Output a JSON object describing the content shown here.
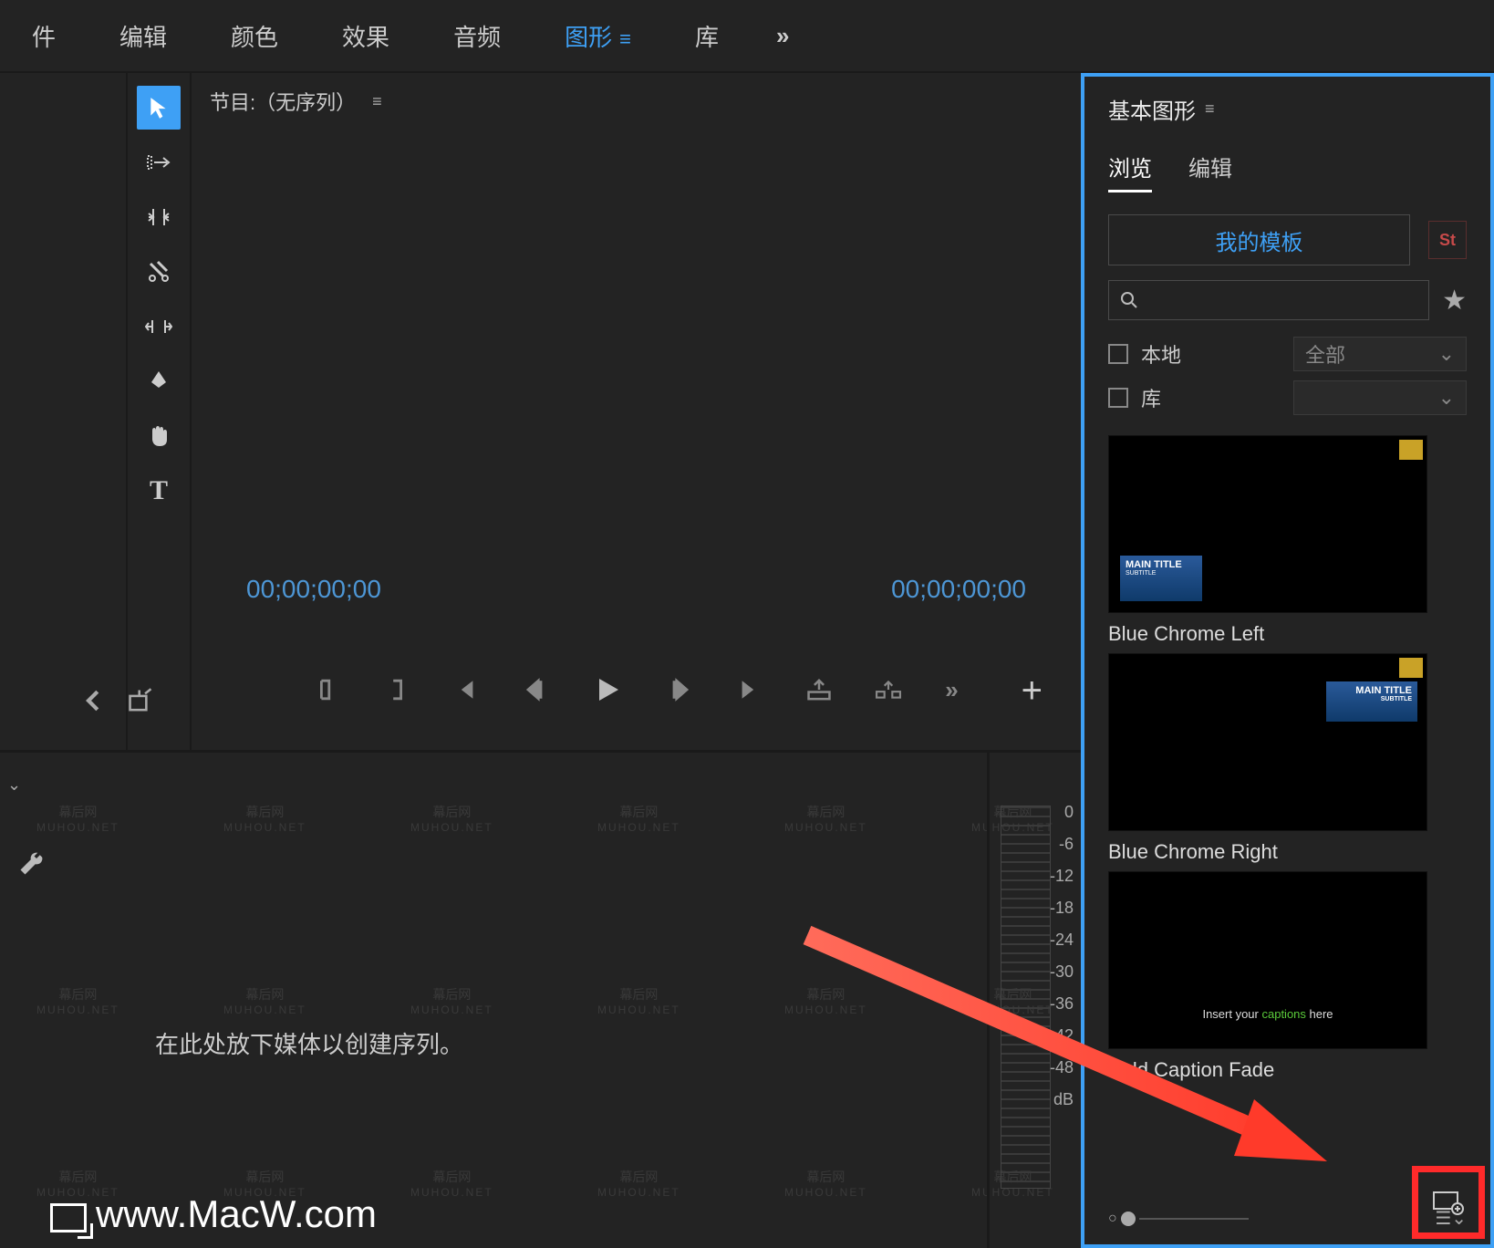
{
  "top_menu": {
    "items": [
      "件",
      "编辑",
      "颜色",
      "效果",
      "音频",
      "图形",
      "库"
    ],
    "active_index": 5,
    "more_glyph": "»"
  },
  "toolbar": {
    "tools": [
      {
        "name": "selection-tool",
        "glyph": "▲"
      },
      {
        "name": "track-select-tool",
        "glyph": "⟶"
      },
      {
        "name": "ripple-edit-tool",
        "glyph": "⇵"
      },
      {
        "name": "razor-tool",
        "glyph": "◆"
      },
      {
        "name": "slip-tool",
        "glyph": "|↔|"
      },
      {
        "name": "pen-tool",
        "glyph": "✒"
      },
      {
        "name": "hand-tool",
        "glyph": "✋"
      },
      {
        "name": "type-tool",
        "glyph": "T"
      }
    ]
  },
  "program": {
    "title": "节目:（无序列）",
    "tc_left": "00;00;00;00",
    "tc_right": "00;00;00;00",
    "plus": "+",
    "transport": [
      "mark-in",
      "mark-out",
      "go-start",
      "step-back",
      "play",
      "step-fwd",
      "go-end",
      "lift",
      "extract",
      "more"
    ]
  },
  "essential_graphics": {
    "title": "基本图形",
    "tabs": {
      "browse": "浏览",
      "edit": "编辑"
    },
    "my_templates": "我的模板",
    "stock_badge": "St",
    "search_placeholder": "",
    "filters": {
      "local": "本地",
      "library": "库",
      "all": "全部"
    },
    "templates": [
      {
        "label": "Blue Chrome Left",
        "main": "MAIN TITLE",
        "sub": "SUBTITLE",
        "variant": "left"
      },
      {
        "label": "Blue Chrome Right",
        "main": "MAIN TITLE",
        "sub": "SUBTITLE",
        "variant": "right"
      },
      {
        "label": "Bold Caption Fade",
        "caption_prefix": "Insert your ",
        "caption_highlight": "captions",
        "caption_suffix": " here",
        "variant": "caption"
      }
    ]
  },
  "timeline": {
    "drop_msg": "在此处放下媒体以创建序列。"
  },
  "audio_meter": {
    "ticks": [
      "0",
      "-6",
      "-12",
      "-18",
      "-24",
      "-30",
      "-36",
      "-42",
      "-48",
      "dB"
    ]
  },
  "watermark": {
    "site": "www.MacW.com",
    "wm_label1": "幕后网",
    "wm_label2": "MUHOU.NET"
  }
}
